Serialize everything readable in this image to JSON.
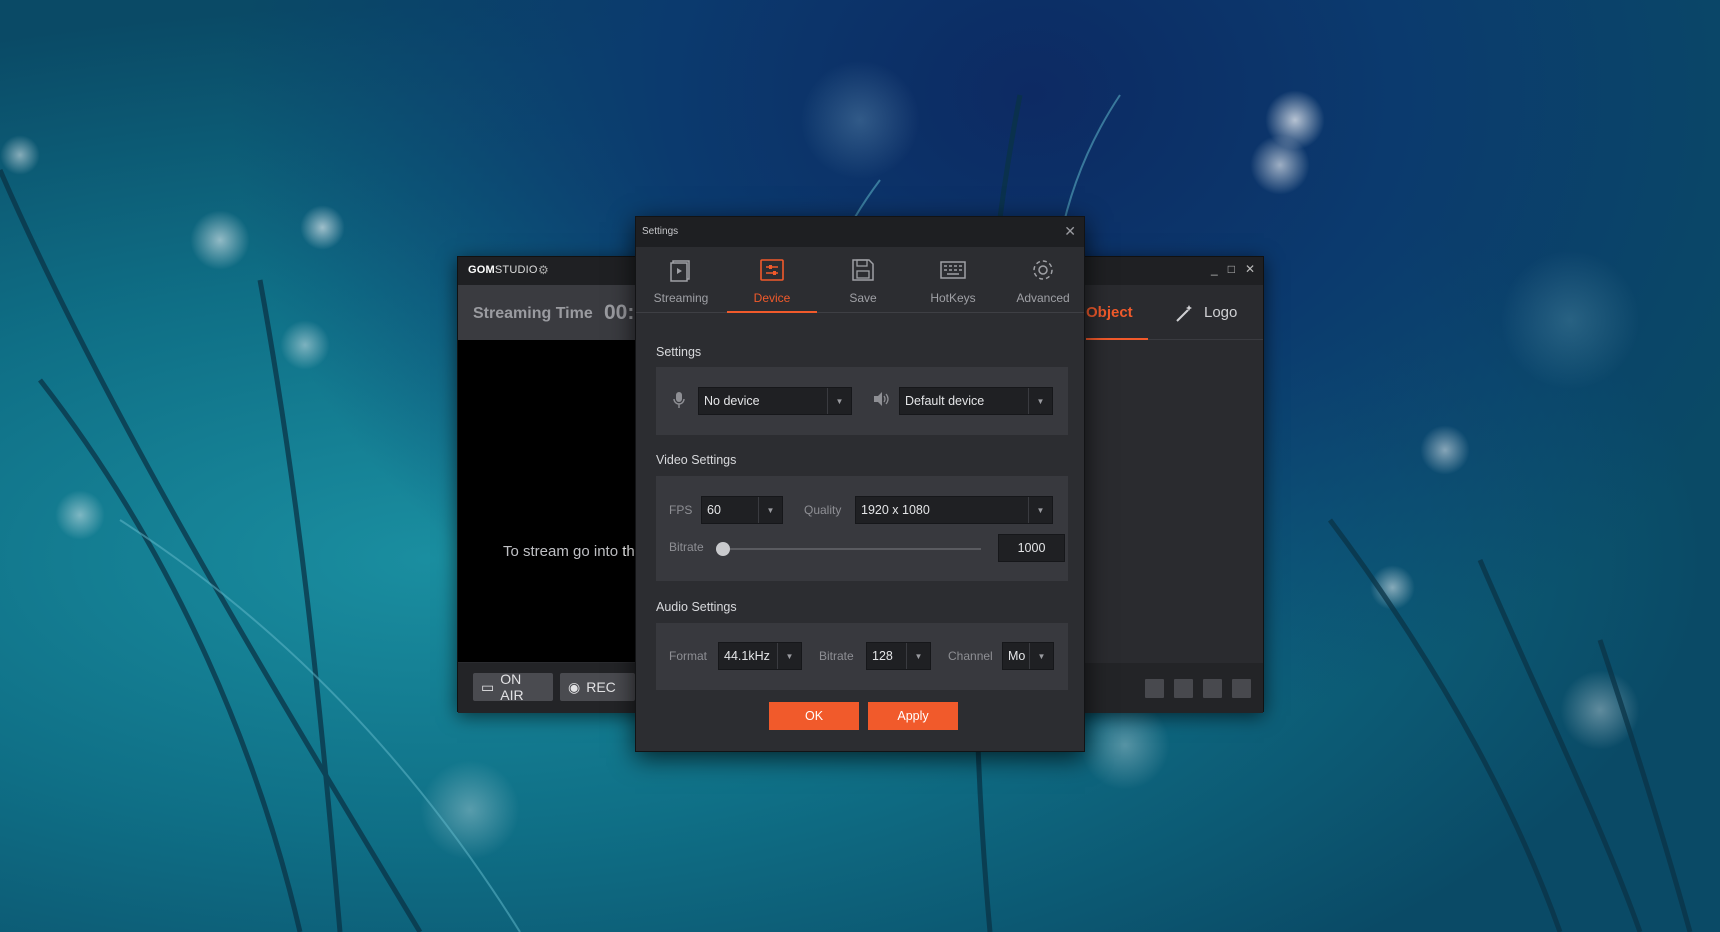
{
  "main_window": {
    "logo_brand": "GOM",
    "logo_product": "STUDIO",
    "streaming_label": "Streaming Time",
    "streaming_time": "00:",
    "preview_text": "To stream go into ",
    "preview_text_cont": "th",
    "on_air_label": "ON AIR",
    "rec_label": "REC",
    "tab_object": "Object",
    "tab_logo": "Logo"
  },
  "dialog": {
    "title": "Settings",
    "tabs": [
      {
        "label": "Streaming",
        "icon": "streaming-icon"
      },
      {
        "label": "Device",
        "icon": "device-icon"
      },
      {
        "label": "Save",
        "icon": "save-icon"
      },
      {
        "label": "HotKeys",
        "icon": "hotkeys-icon"
      },
      {
        "label": "Advanced",
        "icon": "advanced-gear-icon"
      }
    ],
    "active_tab": "Device",
    "settings": {
      "heading": "Settings",
      "mic_device": "No device",
      "speaker_device": "Default device"
    },
    "video": {
      "heading": "Video Settings",
      "fps_label": "FPS",
      "fps_value": "60",
      "quality_label": "Quality",
      "quality_value": "1920 x 1080",
      "bitrate_label": "Bitrate",
      "bitrate_value": "1000",
      "bitrate_slider_fraction": 0.0
    },
    "audio": {
      "heading": "Audio Settings",
      "format_label": "Format",
      "format_value": "44.1kHz",
      "bitrate_label": "Bitrate",
      "bitrate_value": "128",
      "channel_label": "Channel",
      "channel_value": "Mo"
    },
    "ok_label": "OK",
    "apply_label": "Apply"
  },
  "colors": {
    "accent": "#f15a2b",
    "dialog_bg": "#2c2d31",
    "panel_bg": "#38393e"
  }
}
